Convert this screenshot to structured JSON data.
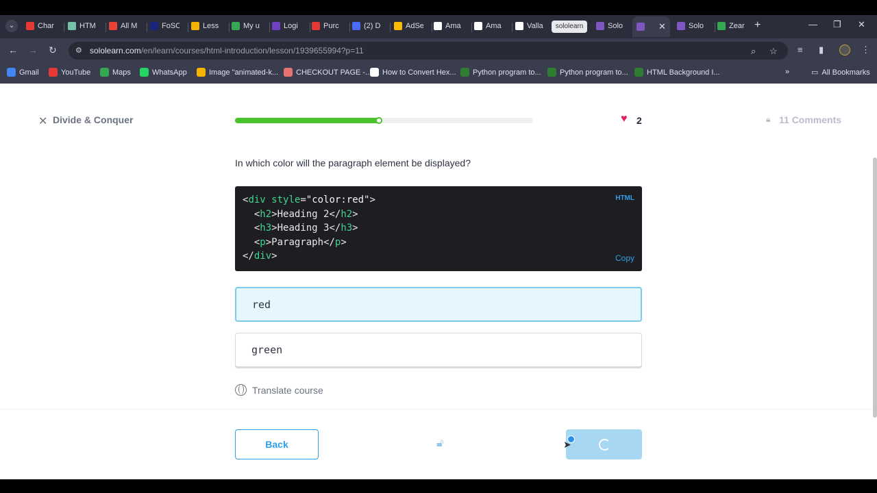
{
  "browser": {
    "tabs": [
      {
        "label": "Char",
        "favicon_color": "#e53935"
      },
      {
        "label": "HTM",
        "favicon_color": "#74c2a8"
      },
      {
        "label": "All M",
        "favicon_color": "#ea4335"
      },
      {
        "label": "FoSC",
        "favicon_color": "#1a237e"
      },
      {
        "label": "Less",
        "favicon_color": "#f4b400"
      },
      {
        "label": "My u",
        "favicon_color": "#34a853"
      },
      {
        "label": "Logi",
        "favicon_color": "#6f42c1"
      },
      {
        "label": "Purc",
        "favicon_color": "#e53935"
      },
      {
        "label": "(2) D",
        "favicon_color": "#4a6cf7"
      },
      {
        "label": "AdSe",
        "favicon_color": "#fbbc04"
      },
      {
        "label": "Ama",
        "favicon_color": "#ffffff"
      },
      {
        "label": "Ama",
        "favicon_color": "#ffffff"
      },
      {
        "label": "Valla",
        "favicon_color": "#ffffff"
      },
      {
        "label": "Solo",
        "favicon_color": "#7e57c2"
      },
      {
        "label": "",
        "favicon_color": "#7e57c2"
      },
      {
        "label": "Solo",
        "favicon_color": "#7e57c2"
      },
      {
        "label": "Zear",
        "favicon_color": "#34a853"
      }
    ],
    "active_tab_chip": "sololearn",
    "url_domain": "sololearn.com",
    "url_path": "/en/learn/courses/html-introduction/lesson/1939655994?p=11",
    "bookmarks": [
      {
        "label": "Gmail",
        "color": "#4285f4"
      },
      {
        "label": "YouTube",
        "color": "#e53935"
      },
      {
        "label": "Maps",
        "color": "#34a853"
      },
      {
        "label": "WhatsApp",
        "color": "#25d366"
      },
      {
        "label": "Image \"animated-k...",
        "color": "#f4b400"
      },
      {
        "label": "CHECKOUT PAGE -...",
        "color": "#e57373"
      },
      {
        "label": "How to Convert Hex...",
        "color": "#ffffff"
      },
      {
        "label": "Python program to...",
        "color": "#2e7d32"
      },
      {
        "label": "Python program to...",
        "color": "#2e7d32"
      },
      {
        "label": "HTML Background I...",
        "color": "#2e7d32"
      }
    ],
    "all_bookmarks": "All Bookmarks"
  },
  "lesson": {
    "title": "Divide & Conquer",
    "progress_percent": 49,
    "lives": "2",
    "comments": "11 Comments",
    "question": "In which color will the paragraph element be displayed?",
    "code_lang": "HTML",
    "code_copy": "Copy",
    "options": [
      "red",
      "green"
    ],
    "selected_option": 0,
    "translate": "Translate course",
    "back_label": "Back"
  },
  "colors": {
    "accent": "#2e9fe6",
    "progress": "#4bc42c",
    "heart": "#e0245e"
  }
}
